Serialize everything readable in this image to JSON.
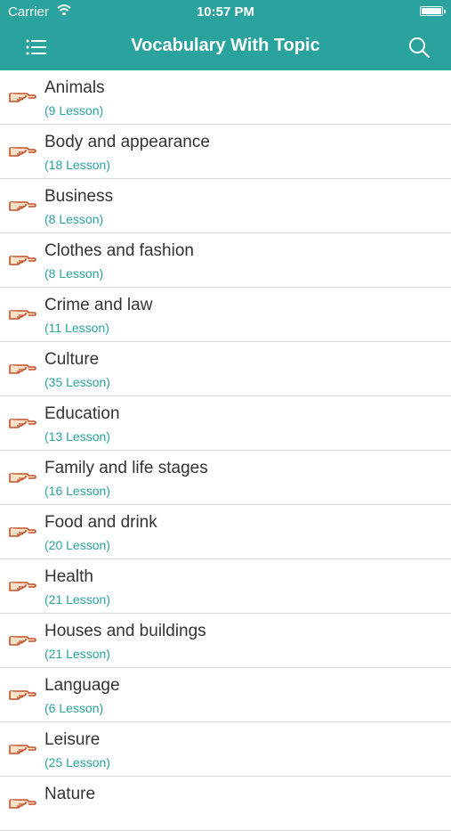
{
  "status_bar": {
    "carrier": "Carrier",
    "time": "10:57 PM"
  },
  "nav": {
    "title": "Vocabulary With Topic",
    "menu_icon": "list-menu-icon",
    "search_icon": "search-icon"
  },
  "colors": {
    "accent": "#2aa29d",
    "row_pointer_icon": "pointing-hand-icon"
  },
  "topics": [
    {
      "name": "Animals",
      "count": "(9 Lesson)"
    },
    {
      "name": "Body and appearance",
      "count": "(18 Lesson)"
    },
    {
      "name": "Business",
      "count": "(8 Lesson)"
    },
    {
      "name": "Clothes and fashion",
      "count": "(8 Lesson)"
    },
    {
      "name": "Crime and law",
      "count": "(11 Lesson)"
    },
    {
      "name": "Culture",
      "count": "(35 Lesson)"
    },
    {
      "name": "Education",
      "count": "(13 Lesson)"
    },
    {
      "name": "Family and life stages",
      "count": "(16 Lesson)"
    },
    {
      "name": "Food and drink",
      "count": "(20 Lesson)"
    },
    {
      "name": "Health",
      "count": "(21 Lesson)"
    },
    {
      "name": "Houses and buildings",
      "count": "(21 Lesson)"
    },
    {
      "name": "Language",
      "count": "(6 Lesson)"
    },
    {
      "name": "Leisure",
      "count": "(25 Lesson)"
    },
    {
      "name": "Nature",
      "count": ""
    }
  ]
}
